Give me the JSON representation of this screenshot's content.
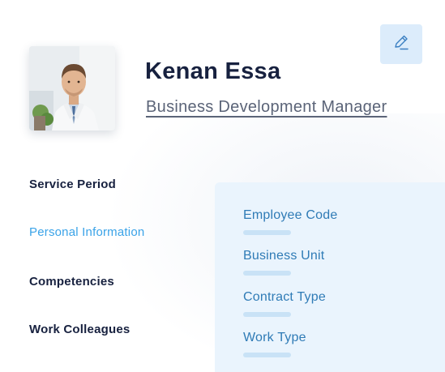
{
  "profile": {
    "name": "Kenan Essa",
    "job_title": "Business Development Manager"
  },
  "toolbar": {
    "edit_icon": "pencil-icon"
  },
  "nav": {
    "items": [
      {
        "label": "Service Period",
        "active": false
      },
      {
        "label": "Personal Information",
        "active": true
      },
      {
        "label": "Competencies",
        "active": false
      },
      {
        "label": "Work Colleagues",
        "active": false
      }
    ]
  },
  "details": {
    "fields": [
      {
        "label": "Employee Code"
      },
      {
        "label": "Business Unit"
      },
      {
        "label": "Contract Type"
      },
      {
        "label": "Work Type"
      }
    ]
  },
  "colors": {
    "accent": "#3aa3e8",
    "heading": "#17213f",
    "panel": "#eaf4fd",
    "field_text": "#2f7bb6"
  }
}
